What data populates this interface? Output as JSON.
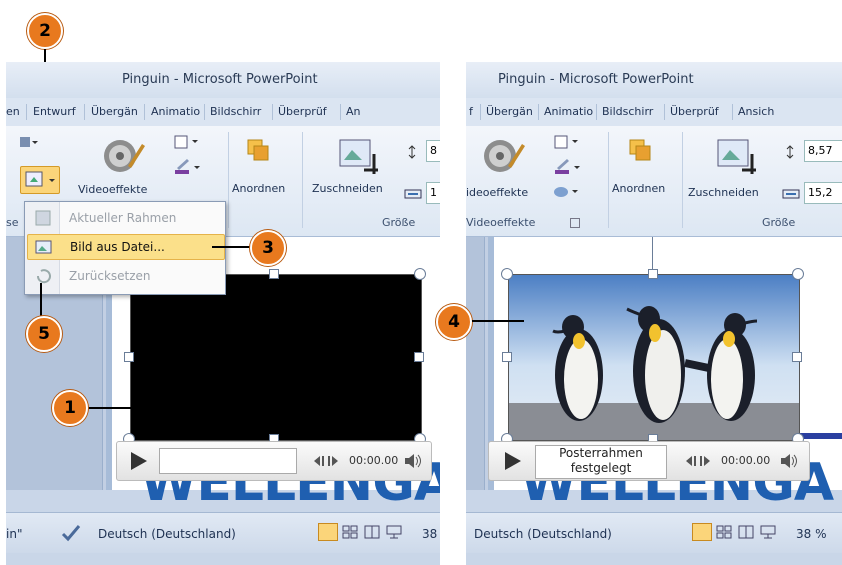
{
  "window": {
    "title": "Pinguin - Microsoft PowerPoint"
  },
  "left": {
    "tabs": [
      "en",
      "Entwurf",
      "Übergän",
      "Animatio",
      "Bildschirr",
      "Überprüf",
      "An"
    ],
    "ribbon": {
      "video_effects_label": "Videoeffekte",
      "arrange_label": "Anordnen",
      "crop_label": "Zuschneiden",
      "size_group": "Größe",
      "partial_group": "se",
      "height_value": "8",
      "width_value": "1"
    },
    "menu": {
      "items": [
        {
          "label": "Aktueller Rahmen",
          "enabled": false
        },
        {
          "label": "Bild aus Datei...",
          "enabled": true,
          "highlighted": true
        },
        {
          "label": "Zurücksetzen",
          "enabled": false
        }
      ]
    },
    "video": {
      "time": "00:00.00"
    },
    "slide_text": "WELLENGA",
    "status": {
      "left_text": "in\"",
      "language": "Deutsch (Deutschland)",
      "zoom": "38"
    }
  },
  "right": {
    "tabs": [
      "f",
      "Übergän",
      "Animatio",
      "Bildschirr",
      "Überprüf",
      "Ansich"
    ],
    "ribbon": {
      "video_effects_label": "ideoeffekte",
      "video_effects_group": "Videoeffekte",
      "arrange_label": "Anordnen",
      "crop_label": "Zuschneiden",
      "size_group": "Größe",
      "height_value": "8,57",
      "width_value": "15,2"
    },
    "video": {
      "time": "00:00.00",
      "poster_line1": "Posterrahmen",
      "poster_line2": "festgelegt"
    },
    "slide_text": "WELLENGA",
    "status": {
      "language": "Deutsch (Deutschland)",
      "zoom": "38 %"
    }
  },
  "callouts": [
    "1",
    "2",
    "3",
    "4",
    "5"
  ],
  "colors": {
    "accent": "#e8791e",
    "menu_highlight": "#fbe08a",
    "ribbon": "#dde7f3",
    "slide_title": "#1f5fb0"
  },
  "icons": [
    "video-effects-icon",
    "poster-frame-icon",
    "arrange-icon",
    "crop-icon",
    "play-icon",
    "volume-icon",
    "normal-view-icon",
    "slide-sorter-icon",
    "reading-view-icon",
    "slideshow-icon",
    "check-icon"
  ]
}
